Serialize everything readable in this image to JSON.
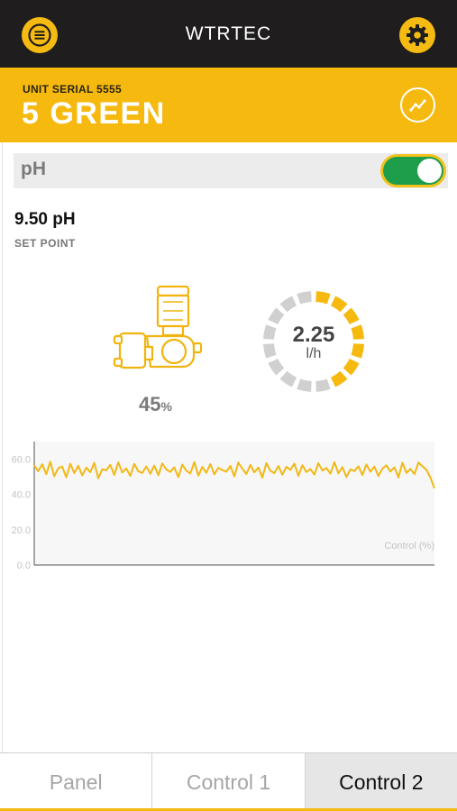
{
  "app": {
    "title": "WTRTEC"
  },
  "icons": {
    "menu": "menu-icon",
    "settings": "gear-icon",
    "trend": "trend-chart-icon"
  },
  "colors": {
    "accent": "#f6b90f",
    "toggle_on": "#1e9e4a",
    "gauge_inactive": "#d0d0d0"
  },
  "unit": {
    "serial_label": "UNIT SERIAL 5555",
    "name": "5 GREEN"
  },
  "sensor": {
    "label": "pH",
    "enabled": true
  },
  "setpoint": {
    "value": "9.50 pH",
    "label": "SET POINT"
  },
  "pump": {
    "percent": "45",
    "percent_unit": "%"
  },
  "flow": {
    "value": "2.25",
    "unit": "l/h",
    "fill_fraction": 0.45
  },
  "chart_data": {
    "type": "line",
    "ylim": [
      0,
      70
    ],
    "yticks": [
      "60.0",
      "40.0",
      "20.0",
      "0.0"
    ],
    "legend": "Control (%)",
    "grid": false,
    "series": [
      {
        "name": "Control (%)",
        "values": [
          56.5,
          53.2,
          57.1,
          51.5,
          58.6,
          50.3,
          54.9,
          55.8,
          49.7,
          57.4,
          52.1,
          56.3,
          50.8,
          55.2,
          52.6,
          57.9,
          49.2,
          54.3,
          53.7,
          56.8,
          51.1,
          58.2,
          52.4,
          54.8,
          50.5,
          57.3,
          53.1,
          52.2,
          55.9,
          51.7,
          56.4,
          50.9,
          57.6,
          54.1,
          52.8,
          55.4,
          49.8,
          56.9,
          53.5,
          51.9,
          58.4,
          50.7,
          55.6,
          52.3,
          57.2,
          51.4,
          55.1,
          53.8,
          52.9,
          56.2,
          50.2,
          58.1,
          54.6,
          51.6,
          56.7,
          52.5,
          55.3,
          49.5,
          57.8,
          53.4,
          52.1,
          56.1,
          51.2,
          55.7,
          53.9,
          57.5,
          50.6,
          56.6,
          52.7,
          54.4,
          51.3,
          57.7,
          53.6,
          55.0,
          51.8,
          58.3,
          52.0,
          55.5,
          49.9,
          54.2,
          53.3,
          56.0,
          51.0,
          57.0,
          52.9,
          55.8,
          50.4,
          54.7,
          56.5,
          53.0,
          55.4,
          49.6,
          58.0,
          52.2,
          54.5,
          51.5,
          58.1,
          56.0,
          53.9,
          49.5,
          43.5
        ]
      }
    ]
  },
  "tabs": [
    {
      "label": "Panel",
      "active": false
    },
    {
      "label": "Control 1",
      "active": false
    },
    {
      "label": "Control 2",
      "active": true
    }
  ]
}
